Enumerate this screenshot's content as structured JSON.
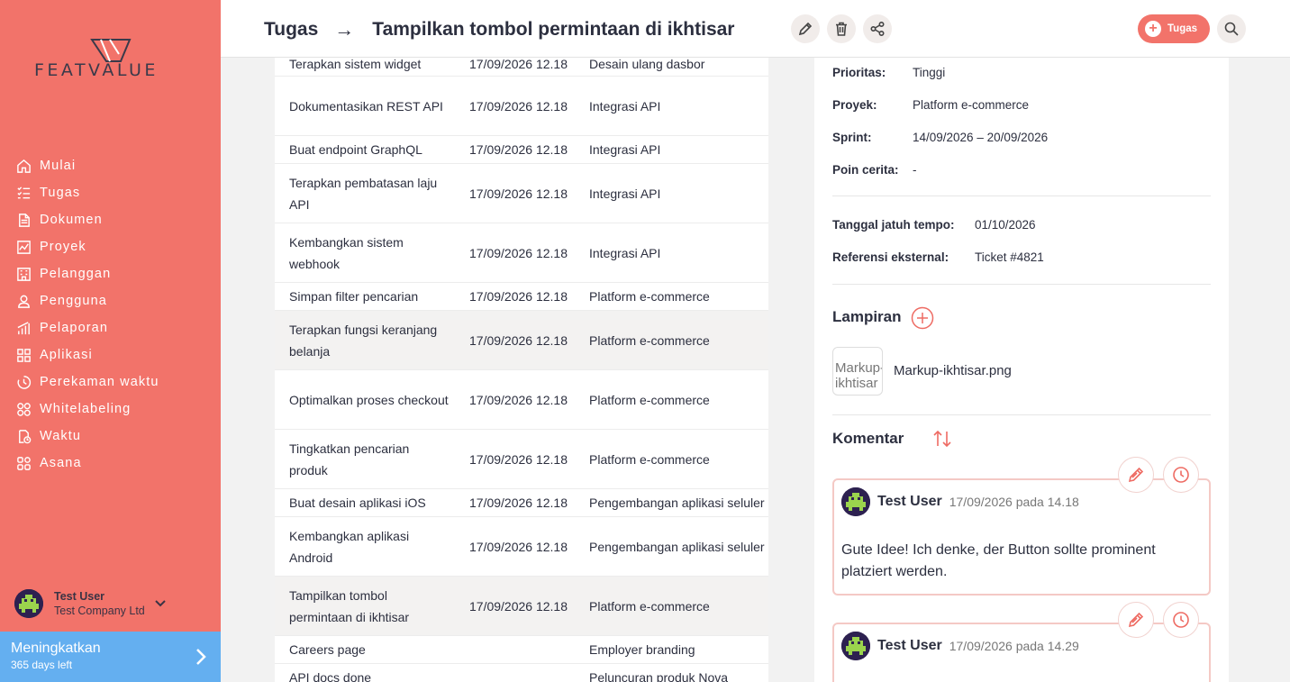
{
  "brand": {
    "name": "FEATVALUE"
  },
  "sidebar": {
    "items": [
      {
        "label": "Mulai",
        "icon": "home-icon"
      },
      {
        "label": "Tugas",
        "icon": "tasks-icon"
      },
      {
        "label": "Dokumen",
        "icon": "documents-icon"
      },
      {
        "label": "Proyek",
        "icon": "projects-icon"
      },
      {
        "label": "Pelanggan",
        "icon": "customers-icon"
      },
      {
        "label": "Pengguna",
        "icon": "user-icon"
      },
      {
        "label": "Pelaporan",
        "icon": "reports-icon"
      },
      {
        "label": "Aplikasi",
        "icon": "apps-icon"
      },
      {
        "label": "Perekaman waktu",
        "icon": "timer-icon"
      },
      {
        "label": "Whitelabeling",
        "icon": "whitelabel-icon"
      },
      {
        "label": "Waktu",
        "icon": "time-icon"
      },
      {
        "label": "Asana",
        "icon": "asana-icon"
      }
    ],
    "user": {
      "name": "Test User",
      "company": "Test Company Ltd"
    },
    "upgrade": {
      "title": "Meningkatkan",
      "subtitle": "365 days left"
    }
  },
  "header": {
    "section": "Tugas",
    "arrow": "→",
    "title": "Tampilkan tombol permintaan di ikhtisar",
    "new_task_label": "Tugas"
  },
  "tasks": [
    {
      "name": "Terapkan sistem widget",
      "date": "17/09/2026 12.18",
      "project": "Desain ulang dasbor"
    },
    {
      "name": "Dokumentasikan REST API",
      "date": "17/09/2026 12.18",
      "project": "Integrasi API"
    },
    {
      "name": "Buat endpoint GraphQL",
      "date": "17/09/2026 12.18",
      "project": "Integrasi API"
    },
    {
      "name": "Terapkan pembatasan laju API",
      "date": "17/09/2026 12.18",
      "project": "Integrasi API"
    },
    {
      "name": "Kembangkan sistem webhook",
      "date": "17/09/2026 12.18",
      "project": "Integrasi API"
    },
    {
      "name": "Simpan filter pencarian",
      "date": "17/09/2026 12.18",
      "project": "Platform e-commerce"
    },
    {
      "name": "Terapkan fungsi keranjang belanja",
      "date": "17/09/2026 12.18",
      "project": "Platform e-commerce"
    },
    {
      "name": "Optimalkan proses checkout",
      "date": "17/09/2026 12.18",
      "project": "Platform e-commerce"
    },
    {
      "name": "Tingkatkan pencarian produk",
      "date": "17/09/2026 12.18",
      "project": "Platform e-commerce"
    },
    {
      "name": "Buat desain aplikasi iOS",
      "date": "17/09/2026 12.18",
      "project": "Pengembangan aplikasi seluler"
    },
    {
      "name": "Kembangkan aplikasi Android",
      "date": "17/09/2026 12.18",
      "project": "Pengembangan aplikasi seluler"
    },
    {
      "name": "Tampilkan tombol permintaan di ikhtisar",
      "date": "17/09/2026 12.18",
      "project": "Platform e-commerce"
    },
    {
      "name": "Careers page",
      "date": "",
      "project": "Employer branding"
    },
    {
      "name": "API docs done",
      "date": "",
      "project": "Peluncuran produk Nova"
    }
  ],
  "details": {
    "priority_label": "Prioritas:",
    "priority": "Tinggi",
    "project_label": "Proyek:",
    "project": "Platform e-commerce",
    "sprint_label": "Sprint:",
    "sprint": "14/09/2026 – 20/09/2026",
    "points_label": "Poin cerita:",
    "points": "-",
    "due_label": "Tanggal jatuh tempo:",
    "due": "01/10/2026",
    "ref_label": "Referensi eksternal:",
    "ref": "Ticket #4821"
  },
  "attachments": {
    "title": "Lampiran",
    "thumb_alt": "Markup-ikhtisar",
    "file": "Markup-ikhtisar.png"
  },
  "comments": {
    "title": "Komentar",
    "items": [
      {
        "author": "Test User",
        "date": "17/09/2026 pada 14.18",
        "text": "Gute Idee! Ich denke, der Button sollte prominent platziert werden."
      },
      {
        "author": "Test User",
        "date": "17/09/2026 pada 14.29",
        "text": ""
      }
    ]
  },
  "colors": {
    "brand": "#f2736a",
    "upgrade": "#64aff0",
    "dark": "#2c2f3f"
  }
}
